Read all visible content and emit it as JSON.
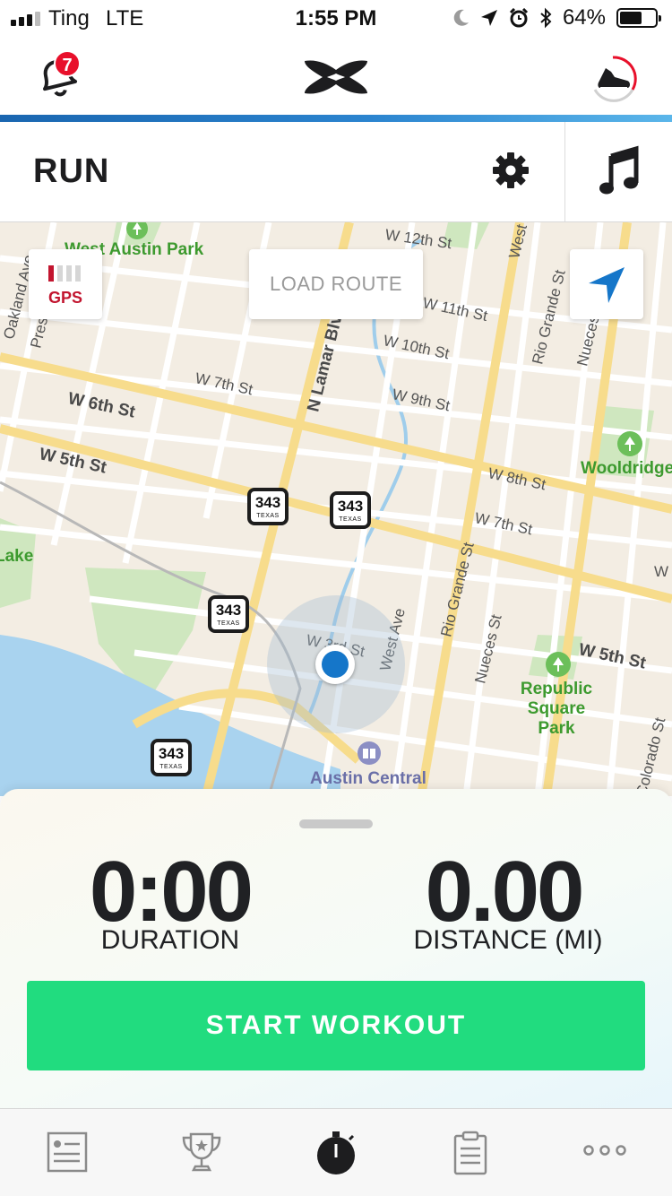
{
  "status_bar": {
    "carrier": "Ting",
    "network": "LTE",
    "time": "1:55 PM",
    "battery": "64%",
    "battery_level": 0.64
  },
  "header": {
    "notification_count": "7",
    "brand_icon": "under-armour-logo",
    "colors": {
      "accent_blue": "#1a66b0",
      "badge_red": "#e8102b"
    }
  },
  "toolbar": {
    "title": "RUN",
    "settings_icon": "gear-icon",
    "music_icon": "music-note-icon"
  },
  "map": {
    "gps_label": "GPS",
    "load_route_label": "LOAD ROUTE",
    "streets": [
      "W 12th St",
      "W 11th St",
      "W 10th St",
      "W 9th St",
      "W 8th St",
      "W 7th St",
      "W 6th St",
      "W 5th St",
      "W 5th St",
      "W 7th St",
      "N Lamar Blvd",
      "West Ave",
      "West Ave",
      "Rio Grande St",
      "Rio Grande St",
      "Nueces St",
      "Nueces",
      "Colorado St",
      "Oakland Ave",
      "Pressler",
      "W 3rd St",
      "Lake",
      "W"
    ],
    "parks": [
      "West Austin Park",
      "Wooldridge Square Park",
      "Republic Square Park"
    ],
    "poi": "Austin Central",
    "highway_number": "343",
    "highway_state": "TEXAS"
  },
  "workout": {
    "duration_value": "0:00",
    "duration_label": "DURATION",
    "distance_value": "0.00",
    "distance_label": "DISTANCE (MI)",
    "start_label": "START WORKOUT",
    "colors": {
      "start_green": "#21dc7f"
    }
  },
  "tabs": [
    {
      "icon": "feed-icon"
    },
    {
      "icon": "trophy-icon"
    },
    {
      "icon": "stopwatch-icon"
    },
    {
      "icon": "clipboard-icon"
    },
    {
      "icon": "more-icon"
    }
  ]
}
